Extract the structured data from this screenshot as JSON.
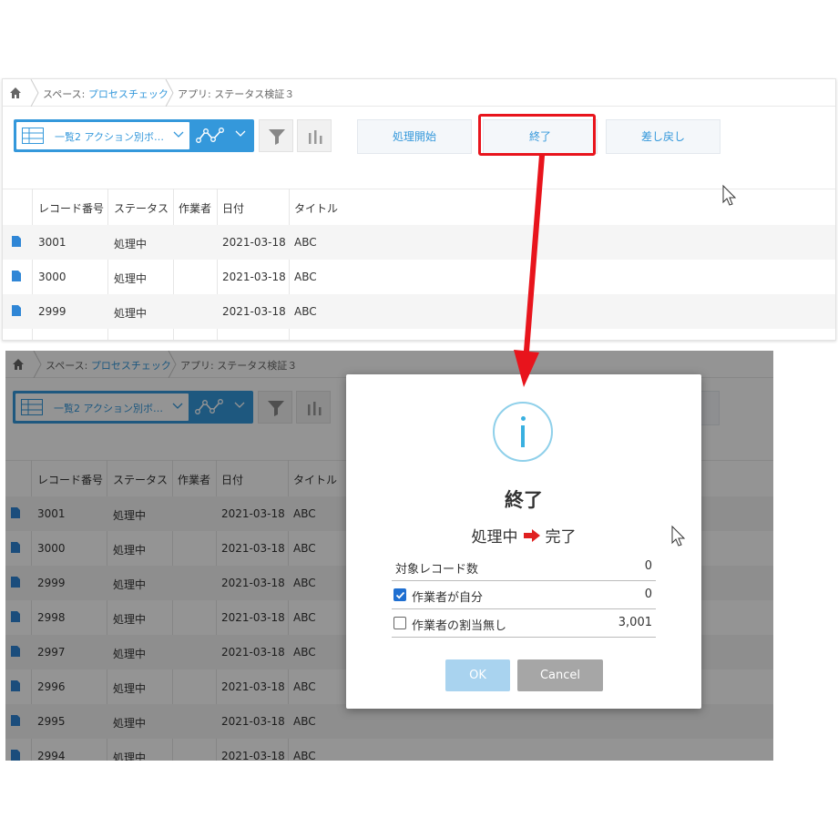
{
  "breadcrumb": {
    "space_prefix": "スペース: ",
    "space_name": "プロセスチェック",
    "app_label": "アプリ: ステータス検証３"
  },
  "toolbar": {
    "view_label": "一覧2 アクション別ボ…",
    "actions": [
      "処理開始",
      "終了",
      "差し戻し"
    ]
  },
  "table": {
    "columns": [
      "レコード番号",
      "ステータス",
      "作業者",
      "日付",
      "タイトル"
    ],
    "rows": [
      {
        "id": "3001",
        "status": "処理中",
        "assignee": "",
        "date": "2021-03-18",
        "title": "ABC"
      },
      {
        "id": "3000",
        "status": "処理中",
        "assignee": "",
        "date": "2021-03-18",
        "title": "ABC"
      },
      {
        "id": "2999",
        "status": "処理中",
        "assignee": "",
        "date": "2021-03-18",
        "title": "ABC"
      },
      {
        "id": "2998",
        "status": "処理中",
        "assignee": "",
        "date": "2021-03-18",
        "title": "ABC"
      },
      {
        "id": "2997",
        "status": "処理中",
        "assignee": "",
        "date": "2021-03-18",
        "title": "ABC"
      },
      {
        "id": "2996",
        "status": "処理中",
        "assignee": "",
        "date": "2021-03-18",
        "title": "ABC"
      },
      {
        "id": "2995",
        "status": "処理中",
        "assignee": "",
        "date": "2021-03-18",
        "title": "ABC"
      },
      {
        "id": "2994",
        "status": "処理中",
        "assignee": "",
        "date": "2021-03-18",
        "title": "ABC"
      }
    ]
  },
  "dialog": {
    "icon": "info-icon",
    "title": "終了",
    "from_status": "処理中",
    "to_status": "完了",
    "rows": [
      {
        "label": "対象レコード数",
        "value": "0",
        "checkbox": null
      },
      {
        "label": "作業者が自分",
        "value": "0",
        "checkbox": true
      },
      {
        "label": "作業者の割当無し",
        "value": "3,001",
        "checkbox": false
      }
    ],
    "ok_label": "OK",
    "cancel_label": "Cancel"
  },
  "colors": {
    "accent": "#3498db",
    "highlight": "#e8141c",
    "info": "#39b0e0"
  }
}
